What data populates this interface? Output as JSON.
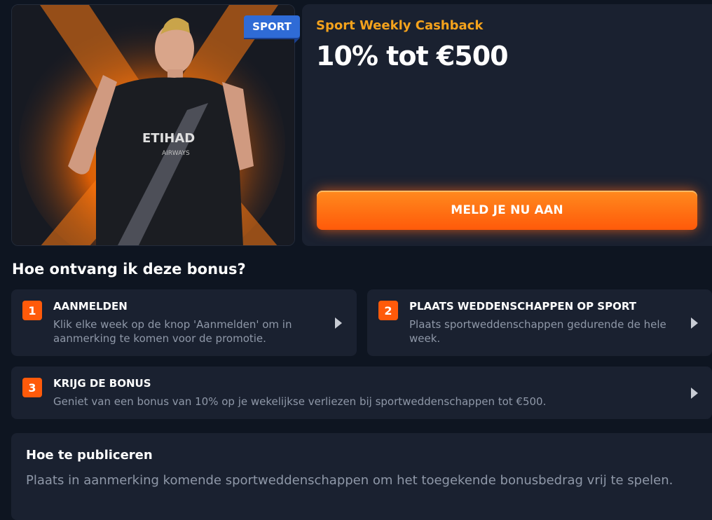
{
  "badge": {
    "label": "SPORT"
  },
  "promo": {
    "category": "Sport Weekly Cashback",
    "amount": "10% tot €500",
    "cta_label": "MELD JE NU AAN"
  },
  "howto": {
    "title": "Hoe ontvang ik deze bonus?",
    "steps": [
      {
        "number": "1",
        "title": "AANMELDEN",
        "description": "Klik elke week op de knop 'Aanmelden' om in aanmerking te komen voor de promotie."
      },
      {
        "number": "2",
        "title": "PLAATS WEDDENSCHAPPEN OP SPORT",
        "description": "Plaats sportweddenschappen gedurende de hele week."
      },
      {
        "number": "3",
        "title": "KRIJG DE BONUS",
        "description": "Geniet van een bonus van 10% op je wekelijkse verliezen bij sportweddenschappen tot €500."
      }
    ]
  },
  "publish": {
    "title": "Hoe te publiceren",
    "text": "Plaats in aanmerking komende sportweddenschappen om het toegekende bonusbedrag vrij te spelen."
  },
  "colors": {
    "background": "#0e1521",
    "card": "#1a2130",
    "accent_orange": "#ff5a0a",
    "accent_gold": "#f4a21c",
    "badge_blue": "#2f6bd6",
    "muted_text": "#8f98a8"
  },
  "icons": [
    "chevron-right-icon"
  ]
}
